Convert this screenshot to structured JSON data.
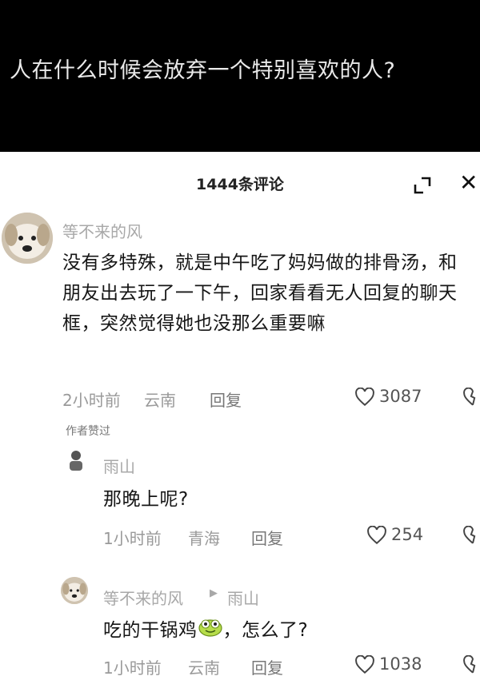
{
  "video": {
    "question": "人在什么时候会放弃一个特别喜欢的人?"
  },
  "header": {
    "title": "1444条评论"
  },
  "comments": [
    {
      "author": "等不来的风",
      "text": "没有多特殊，就是中午吃了妈妈做的排骨汤，和朋友出去玩了一下午，回家看看无人回复的聊天框，突然觉得她也没那么重要嘛",
      "time": "2小时前",
      "location": "云南",
      "reply_label": "回复",
      "likes": "3087",
      "author_liked": "作者赞过"
    }
  ],
  "replies": [
    {
      "author": "雨山",
      "text": "那晚上呢?",
      "time": "1小时前",
      "location": "青海",
      "reply_label": "回复",
      "likes": "254"
    },
    {
      "author": "等不来的风",
      "reply_to": "雨山",
      "text_before": "吃的干锅鸡",
      "text_after": "，怎么了?",
      "time": "1小时前",
      "location": "云南",
      "reply_label": "回复",
      "likes": "1038"
    }
  ]
}
